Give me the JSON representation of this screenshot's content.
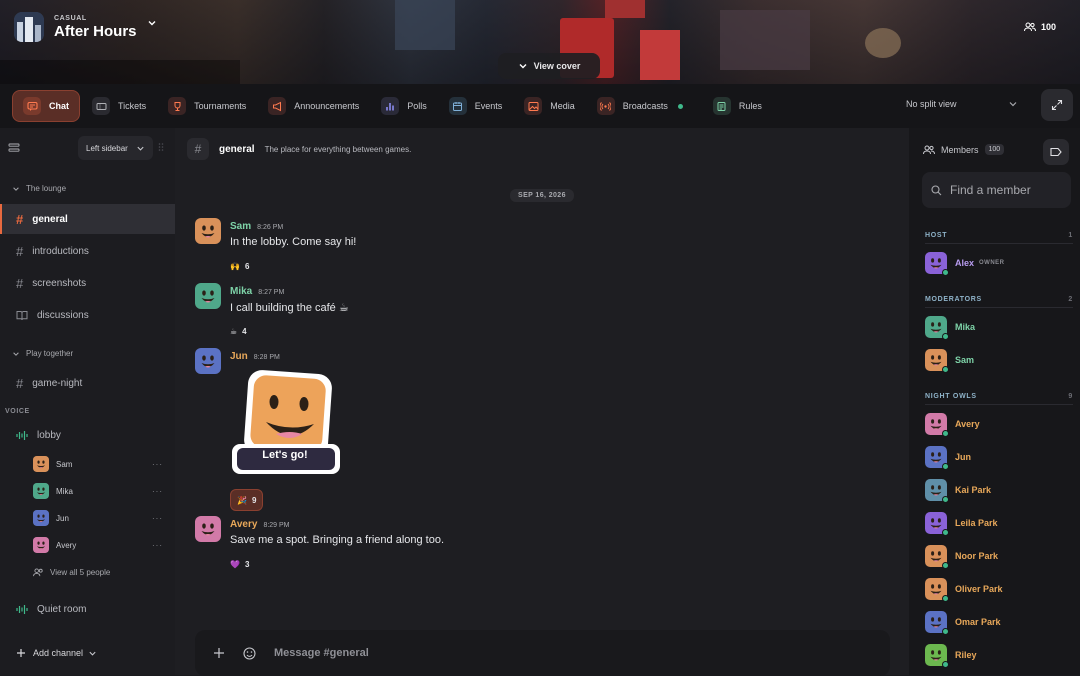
{
  "server": {
    "subtitle": "CASUAL",
    "name": "After Hours",
    "member_count": "100",
    "view_cover": "View cover"
  },
  "tabs": [
    {
      "label": "Chat",
      "icon": "chat-icon",
      "active": true
    },
    {
      "label": "Tickets",
      "icon": "ticket-icon"
    },
    {
      "label": "Tournaments",
      "icon": "trophy-icon"
    },
    {
      "label": "Announcements",
      "icon": "megaphone-icon"
    },
    {
      "label": "Polls",
      "icon": "bar-chart-icon"
    },
    {
      "label": "Events",
      "icon": "calendar-icon"
    },
    {
      "label": "Media",
      "icon": "image-icon"
    },
    {
      "label": "Broadcasts",
      "icon": "broadcast-icon",
      "live": true
    },
    {
      "label": "Rules",
      "icon": "rules-icon"
    }
  ],
  "split_view": "No split view",
  "sidebar": {
    "layout_label": "Left sidebar",
    "categories": [
      {
        "label": "The lounge"
      },
      {
        "label": "Play together"
      }
    ],
    "channels": [
      {
        "label": "general",
        "type": "text",
        "active": true
      },
      {
        "label": "introductions",
        "type": "text"
      },
      {
        "label": "screenshots",
        "type": "text"
      },
      {
        "label": "discussions",
        "type": "forum"
      },
      {
        "label": "game-night",
        "type": "text"
      }
    ],
    "voice_label": "VOICE",
    "voice_channels": [
      {
        "label": "lobby"
      },
      {
        "label": "Quiet room"
      }
    ],
    "voice_users": [
      {
        "name": "Sam",
        "color": "#d9915a"
      },
      {
        "name": "Mika",
        "color": "#4fa88a"
      },
      {
        "name": "Jun",
        "color": "#5b72c4"
      },
      {
        "name": "Avery",
        "color": "#d27aa8"
      }
    ],
    "more": "···",
    "view_all": "View all 5 people",
    "add_channel": "Add channel"
  },
  "channel_header": {
    "name": "general",
    "topic": "The place for everything between games."
  },
  "date_divider": "SEP 16, 2026",
  "messages": [
    {
      "author": "Sam",
      "time": "8:26 PM",
      "text": "In the lobby. Come say hi!",
      "author_color": "#7ed3a8",
      "avatar_color": "#d9915a",
      "reaction": {
        "emoji": "🙌",
        "count": "6"
      }
    },
    {
      "author": "Mika",
      "time": "8:27 PM",
      "text": "I call building the café ☕",
      "author_color": "#7ed3a8",
      "avatar_color": "#4fa88a",
      "reaction": {
        "emoji": "☕",
        "count": "4"
      }
    },
    {
      "author": "Jun",
      "time": "8:28 PM",
      "text": "",
      "author_color": "#e8a85a",
      "avatar_color": "#5b72c4",
      "sticker": "Let's go!",
      "reaction": {
        "emoji": "🎉",
        "count": "9"
      }
    },
    {
      "author": "Avery",
      "time": "8:29 PM",
      "text": "Save me a spot. Bringing a friend along too.",
      "author_color": "#e8a85a",
      "avatar_color": "#d27aa8",
      "reaction": {
        "emoji": "💜",
        "count": "3"
      }
    }
  ],
  "composer": {
    "placeholder": "Message #general"
  },
  "members": {
    "title": "Members",
    "count": "100",
    "search_placeholder": "Find a member",
    "groups": [
      {
        "label": "HOST",
        "count": "1",
        "members": [
          {
            "name": "Alex",
            "badge": "OWNER",
            "name_color": "#b89cf0",
            "avatar_color": "#8a62d8"
          }
        ]
      },
      {
        "label": "MODERATORS",
        "count": "2",
        "members": [
          {
            "name": "Mika",
            "name_color": "#7ed3a8",
            "avatar_color": "#4fa88a"
          },
          {
            "name": "Sam",
            "name_color": "#7ed3a8",
            "avatar_color": "#d9915a"
          }
        ]
      },
      {
        "label": "NIGHT OWLS",
        "count": "9",
        "members": [
          {
            "name": "Avery",
            "name_color": "#e8a85a",
            "avatar_color": "#d27aa8"
          },
          {
            "name": "Jun",
            "name_color": "#e8a85a",
            "avatar_color": "#5b72c4"
          },
          {
            "name": "Kai Park",
            "name_color": "#e8a85a",
            "avatar_color": "#5f8fa8"
          },
          {
            "name": "Leila Park",
            "name_color": "#e8a85a",
            "avatar_color": "#8a62d8"
          },
          {
            "name": "Noor Park",
            "name_color": "#e8a85a",
            "avatar_color": "#d9915a"
          },
          {
            "name": "Oliver Park",
            "name_color": "#e8a85a",
            "avatar_color": "#d9915a"
          },
          {
            "name": "Omar Park",
            "name_color": "#e8a85a",
            "avatar_color": "#5b72c4"
          },
          {
            "name": "Riley",
            "name_color": "#e8a85a",
            "avatar_color": "#6cb84f"
          }
        ]
      }
    ]
  }
}
